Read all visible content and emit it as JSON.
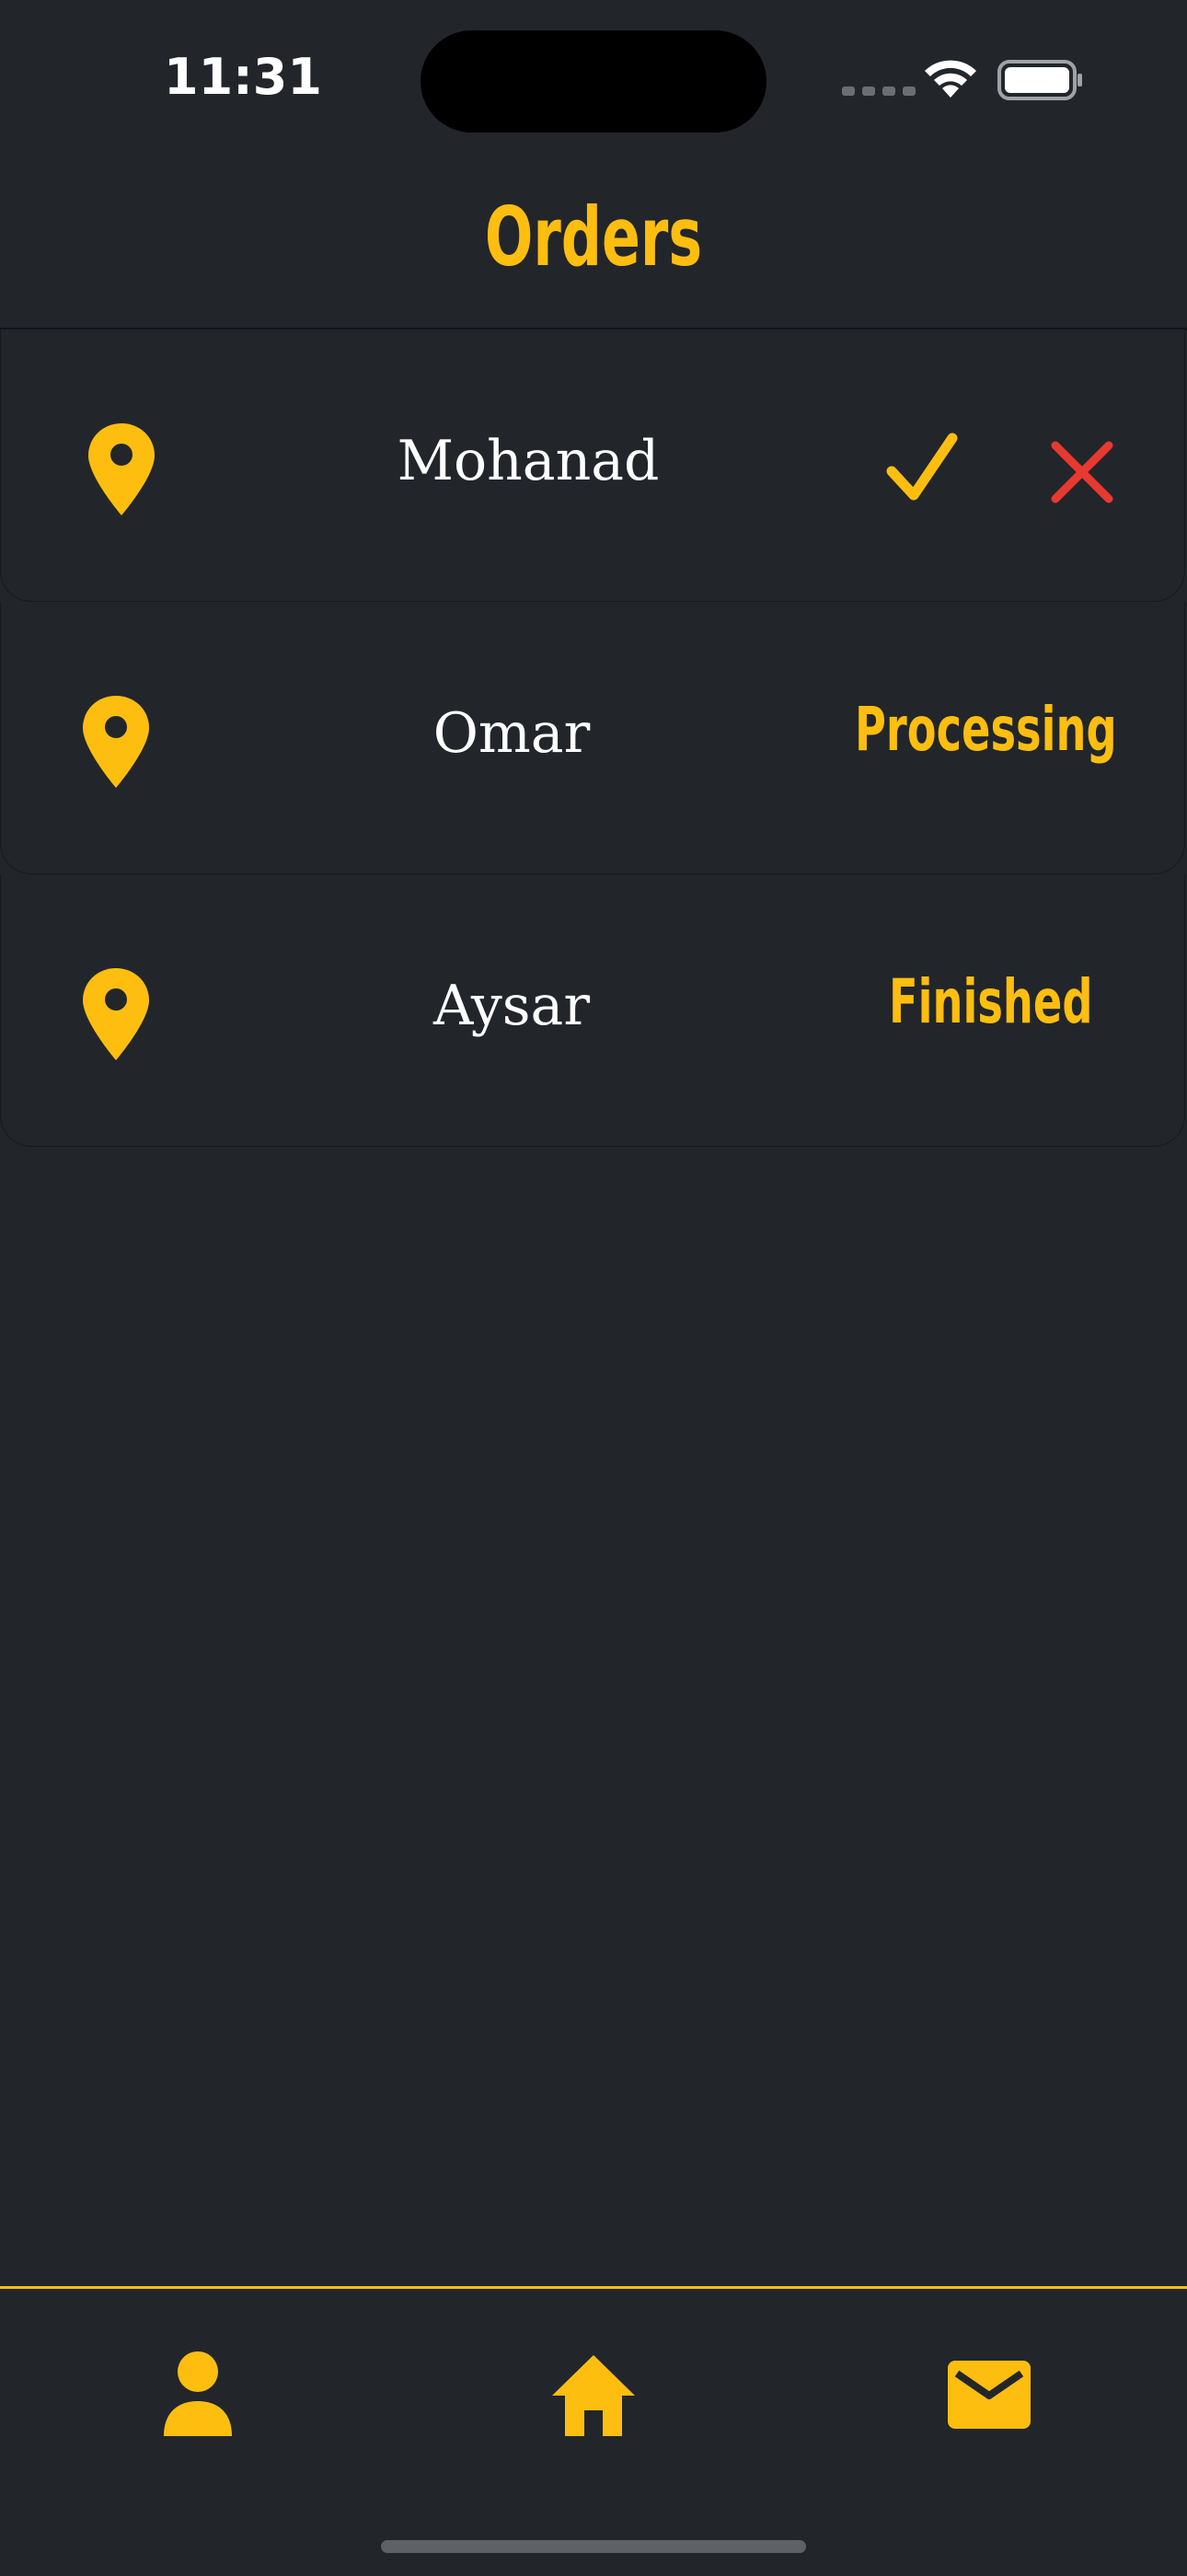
{
  "status_bar": {
    "time": "11:31"
  },
  "header": {
    "title": "Orders"
  },
  "orders": [
    {
      "name": "Mohanad",
      "status": "",
      "actions": [
        "accept",
        "reject"
      ]
    },
    {
      "name": "Omar",
      "status": "Processing"
    },
    {
      "name": "Aysar",
      "status": "Finished"
    }
  ],
  "tab_bar": {
    "items": [
      {
        "icon": "person-icon"
      },
      {
        "icon": "home-icon"
      },
      {
        "icon": "mail-icon"
      }
    ]
  },
  "colors": {
    "accent": "#fdbe10",
    "reject": "#e8392f",
    "background": "#22262b"
  }
}
